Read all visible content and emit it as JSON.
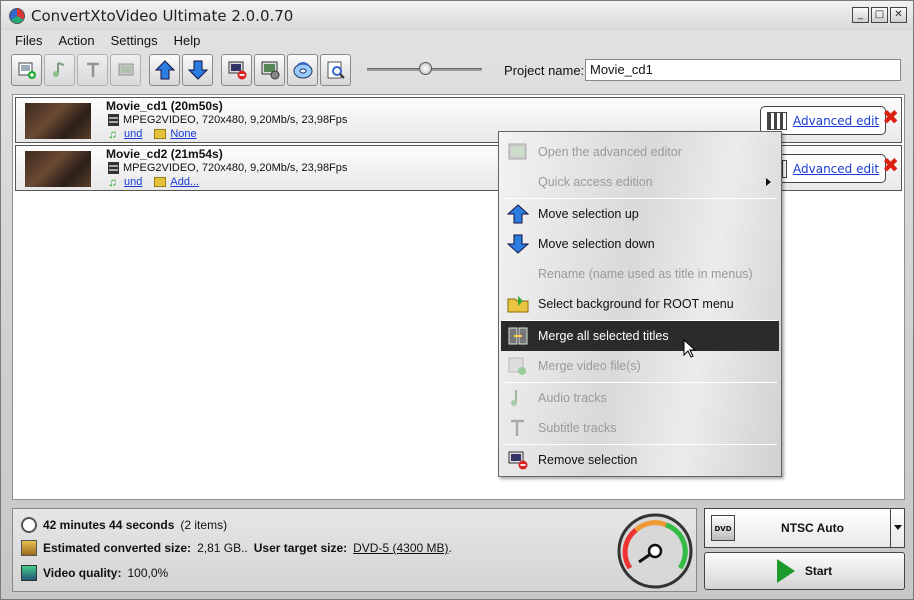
{
  "window": {
    "title": "ConvertXtoVideo Ultimate 2.0.0.70"
  },
  "menu": {
    "items": [
      "Files",
      "Action",
      "Settings",
      "Help"
    ]
  },
  "project": {
    "label": "Project name:",
    "value": "Movie_cd1"
  },
  "titles": [
    {
      "name": "Movie_cd1 (20m50s)",
      "video": "MPEG2VIDEO, 720x480, 9,20Mb/s, 23,98Fps",
      "audio": "und",
      "subtitle": "None",
      "advanced_label": "Advanced edit"
    },
    {
      "name": "Movie_cd2 (21m54s)",
      "video": "MPEG2VIDEO, 720x480, 9,20Mb/s, 23,98Fps",
      "audio": "und",
      "subtitle": "Add...",
      "advanced_label": "Advanced edit"
    }
  ],
  "context_menu": {
    "items": [
      {
        "label": "Open the advanced editor",
        "enabled": false
      },
      {
        "label": "Quick access edition",
        "enabled": false,
        "submenu": true
      },
      {
        "label": "Move selection up",
        "enabled": true
      },
      {
        "label": "Move selection down",
        "enabled": true
      },
      {
        "label": "Rename (name used as title in menus)",
        "enabled": false
      },
      {
        "label": "Select background for ROOT menu",
        "enabled": true
      },
      {
        "label": "Merge all selected titles",
        "enabled": true,
        "selected": true
      },
      {
        "label": "Merge video file(s)",
        "enabled": false
      },
      {
        "label": "Audio tracks",
        "enabled": false
      },
      {
        "label": "Subtitle tracks",
        "enabled": false
      },
      {
        "label": "Remove selection",
        "enabled": true
      }
    ]
  },
  "status": {
    "duration": "42 minutes 44 seconds",
    "items_count": "(2 items)",
    "size_label": "Estimated converted size:",
    "size_value": "2,81 GB..",
    "target_label": "User target size:",
    "target_value": "DVD-5 (4300 MB)",
    "target_suffix": ".",
    "quality_label": "Video quality:",
    "quality_value": "100,0%"
  },
  "output": {
    "format": "NTSC Auto",
    "dvd_text": "DVD",
    "start_label": "Start"
  },
  "colors": {
    "selection": "#2b2b2b",
    "link": "#1a3ad9",
    "start_play": "#1e9a2a",
    "delete": "#d21111"
  }
}
